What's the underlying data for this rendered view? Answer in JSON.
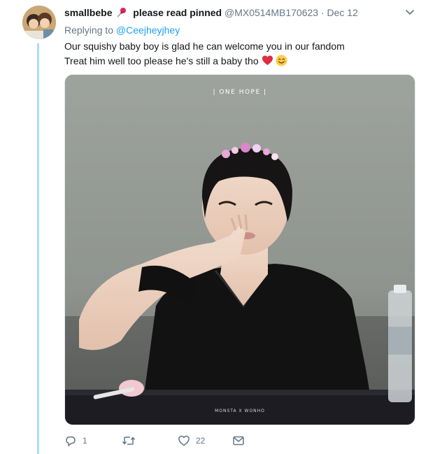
{
  "tweet": {
    "author_name": "smallbebe",
    "pinned_note": "please read pinned",
    "handle": "@MX0514MB170623",
    "separator": "·",
    "date": "Dec 12",
    "reply_prefix": "Replying to",
    "reply_handle": "@Ceejheyjhey",
    "text_line1": "Our squishy baby boy is glad he can welcome you in our fandom",
    "text_line2": "Treat him well too please he's still a baby tho",
    "emojis": [
      "red-heart-emoji",
      "smiling-face-emoji"
    ],
    "media": {
      "watermark_top": "| ONE HOPE |",
      "watermark_bottom": "MONSTA X  WONHO"
    },
    "actions": {
      "reply_count": "1",
      "retweet_count": "",
      "like_count": "22",
      "icons": [
        "reply-icon",
        "retweet-icon",
        "like-icon",
        "direct-message-icon"
      ]
    }
  },
  "colors": {
    "link": "#1da1f2",
    "secondary_text": "#657786",
    "thread_line": "#a9dcf8",
    "primary_text": "#14171a"
  }
}
